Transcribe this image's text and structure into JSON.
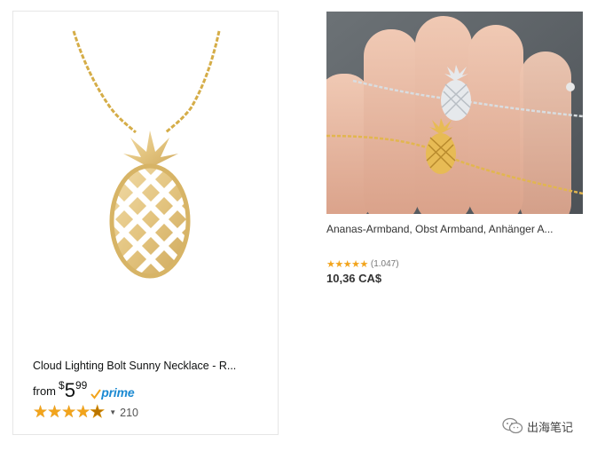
{
  "left_product": {
    "image_icon": "pineapple-necklace-image",
    "title": "Cloud Lighting Bolt Sunny Necklace - R...",
    "from_label": "from",
    "currency": "$",
    "price_whole": "5",
    "price_fraction": "99",
    "prime_label": "prime",
    "rating_stars": 4.5,
    "review_count": "210",
    "colors": {
      "star": "#f2a41c",
      "prime": "#1c8ad2"
    }
  },
  "right_product": {
    "image_icon": "pineapple-bracelet-on-hand-photo",
    "title": "Ananas-Armband, Obst Armband, Anhänger A...",
    "rating_stars": 5,
    "review_count": "(1.047)",
    "price": "10,36 CA$"
  },
  "watermark": {
    "text": "出海笔记",
    "icon": "wechat-icon"
  }
}
